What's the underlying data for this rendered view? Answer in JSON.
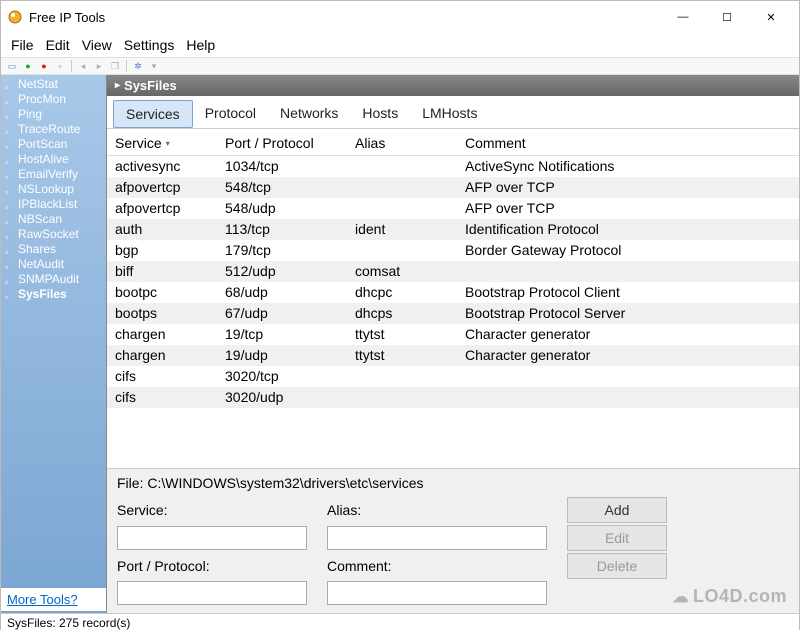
{
  "window": {
    "title": "Free IP Tools",
    "minimize": "—",
    "maximize": "☐",
    "close": "✕"
  },
  "menu": [
    "File",
    "Edit",
    "View",
    "Settings",
    "Help"
  ],
  "sidebar": {
    "items": [
      "NetStat",
      "ProcMon",
      "Ping",
      "TraceRoute",
      "PortScan",
      "HostAlive",
      "EmailVerify",
      "NSLookup",
      "IPBlackList",
      "NBScan",
      "RawSocket",
      "Shares",
      "NetAudit",
      "SNMPAudit",
      "SysFiles"
    ],
    "selected": 14,
    "footer": "More Tools?"
  },
  "panel": {
    "title": "SysFiles",
    "tabs": [
      "Services",
      "Protocol",
      "Networks",
      "Hosts",
      "LMHosts"
    ],
    "active_tab": 0
  },
  "grid": {
    "columns": [
      "Service",
      "Port / Protocol",
      "Alias",
      "Comment"
    ],
    "sort_col": 0,
    "rows": [
      {
        "service": "activesync",
        "port": "1034/tcp",
        "alias": "",
        "comment": "ActiveSync Notifications"
      },
      {
        "service": "afpovertcp",
        "port": "548/tcp",
        "alias": "",
        "comment": "AFP over TCP"
      },
      {
        "service": "afpovertcp",
        "port": "548/udp",
        "alias": "",
        "comment": "AFP over TCP"
      },
      {
        "service": "auth",
        "port": "113/tcp",
        "alias": "ident",
        "comment": "Identification Protocol"
      },
      {
        "service": "bgp",
        "port": "179/tcp",
        "alias": "",
        "comment": "Border Gateway Protocol"
      },
      {
        "service": "biff",
        "port": "512/udp",
        "alias": "comsat",
        "comment": ""
      },
      {
        "service": "bootpc",
        "port": "68/udp",
        "alias": "dhcpc",
        "comment": "Bootstrap Protocol Client"
      },
      {
        "service": "bootps",
        "port": "67/udp",
        "alias": "dhcps",
        "comment": "Bootstrap Protocol Server"
      },
      {
        "service": "chargen",
        "port": "19/tcp",
        "alias": "ttytst",
        "comment": "Character generator"
      },
      {
        "service": "chargen",
        "port": "19/udp",
        "alias": "ttytst",
        "comment": "Character generator"
      },
      {
        "service": "cifs",
        "port": "3020/tcp",
        "alias": "",
        "comment": ""
      },
      {
        "service": "cifs",
        "port": "3020/udp",
        "alias": "",
        "comment": ""
      }
    ]
  },
  "edit": {
    "file_prefix": "File: ",
    "file_path": "C:\\WINDOWS\\system32\\drivers\\etc\\services",
    "labels": {
      "service": "Service:",
      "alias": "Alias:",
      "port": "Port / Protocol:",
      "comment": "Comment:"
    },
    "buttons": {
      "add": "Add",
      "edit": "Edit",
      "delete": "Delete"
    },
    "values": {
      "service": "",
      "alias": "",
      "port": "",
      "comment": ""
    }
  },
  "status": "SysFiles: 275 record(s)",
  "watermark": "LO4D.com"
}
